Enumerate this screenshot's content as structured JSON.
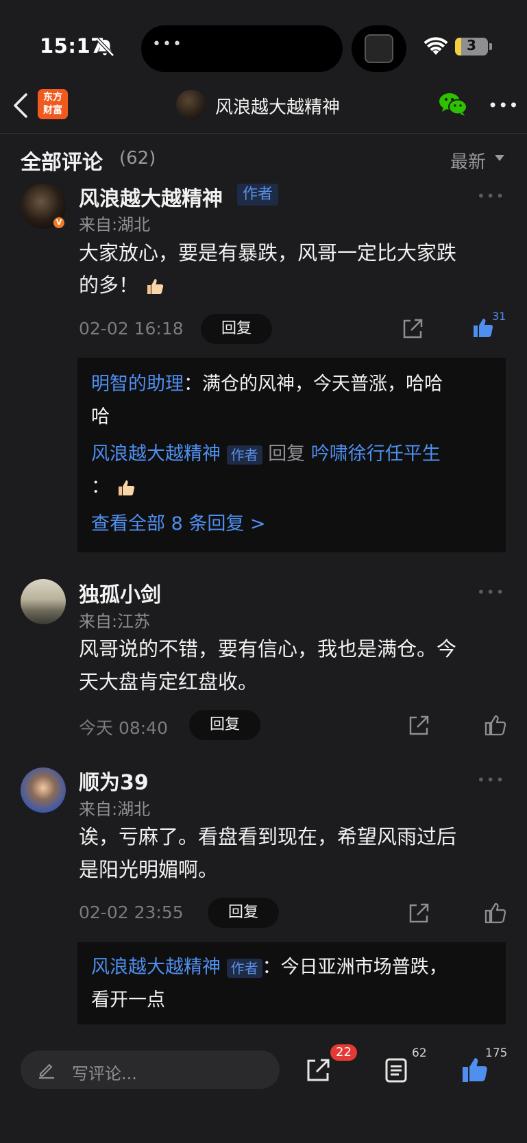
{
  "status_bar": {
    "time": "15:17",
    "battery": "3",
    "island_dots": "•••"
  },
  "header": {
    "logo_line1": "东方",
    "logo_line2": "财富",
    "title": "风浪越大越精神",
    "more": "•••"
  },
  "comments_header": {
    "title": "全部评论",
    "count": "(62)",
    "sort": "最新"
  },
  "comments": [
    {
      "username": "风浪越大越精神",
      "author_tag": "作者",
      "origin": "来自:湖北",
      "text_line1": "大家放心，要是有暴跌，风哥一定比大家跌",
      "text_line2": "的多！",
      "time": "02-02 16:18",
      "reply_label": "回复",
      "likes": "31",
      "replies": [
        {
          "user": "明智的助理",
          "sep": "：",
          "text_line1": "满仓的风神，今天普涨，哈哈",
          "text_line2": "哈"
        },
        {
          "user": "风浪越大越精神",
          "author_tag": "作者",
          "reply_word": "回复",
          "target": "吟啸徐行任平生",
          "sep": "："
        }
      ],
      "view_all": "查看全部 8 条回复 >"
    },
    {
      "username": "独孤小剑",
      "origin": "来自:江苏",
      "text_line1": "风哥说的不错，要有信心，我也是满仓。今",
      "text_line2": "天大盘肯定红盘收。",
      "time": "今天 08:40",
      "reply_label": "回复"
    },
    {
      "username": "顺为39",
      "origin": "来自:湖北",
      "text_line1": "诶，亏麻了。看盘看到现在，希望风雨过后",
      "text_line2": "是阳光明媚啊。",
      "time": "02-02 23:55",
      "reply_label": "回复",
      "replies": [
        {
          "user": "风浪越大越精神",
          "author_tag": "作者",
          "sep": "：",
          "text_line1": "今日亚洲市场普跌，",
          "text_line2": "看开一点"
        }
      ]
    }
  ],
  "bottom_bar": {
    "input_placeholder": "写评论...",
    "share_count": "22",
    "comment_count": "62",
    "like_count": "175"
  },
  "colors": {
    "background": "#1c1c1e",
    "accent_blue": "#4f8ff0",
    "brand_orange": "#f05a1e",
    "badge_red": "#e53935"
  },
  "icons": [
    "bell-slash-icon",
    "wifi-icon",
    "back-icon",
    "wechat-icon",
    "share-icon",
    "thumbs-up-icon",
    "pencil-icon",
    "comment-list-icon"
  ]
}
